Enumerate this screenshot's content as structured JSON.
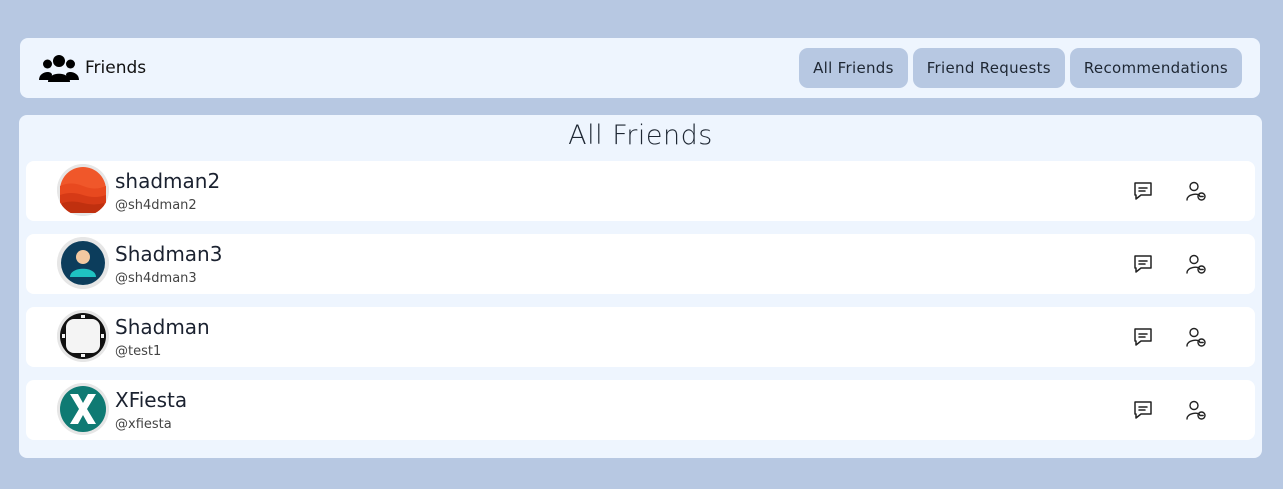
{
  "header": {
    "title": "Friends",
    "icon": "users-group-icon",
    "tabs": [
      {
        "label": "All Friends"
      },
      {
        "label": "Friend Requests"
      },
      {
        "label": "Recommendations"
      }
    ]
  },
  "main": {
    "title": "All Friends",
    "friends": [
      {
        "name": "shadman2",
        "handle": "@sh4dman2"
      },
      {
        "name": "Shadman3",
        "handle": "@sh4dman3"
      },
      {
        "name": "Shadman",
        "handle": "@test1"
      },
      {
        "name": "XFiesta",
        "handle": "@xfiesta"
      }
    ],
    "row_actions": [
      "message-icon",
      "user-remove-icon"
    ]
  },
  "colors": {
    "page_bg": "#b7c8e2",
    "panel_bg": "#eef5fe",
    "tab_bg": "#b7c8e2",
    "row_bg": "#ffffff"
  }
}
